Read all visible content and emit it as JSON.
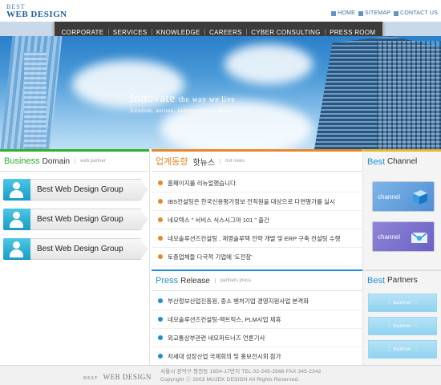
{
  "logo": {
    "line1": "BEST",
    "line2": "WEB DESIGN"
  },
  "util_links": [
    {
      "label": "HOME",
      "icon": "square-bullet-icon"
    },
    {
      "label": "SITEMAP",
      "icon": "square-bullet-icon"
    },
    {
      "label": "CONTACT US",
      "icon": "square-bullet-icon"
    }
  ],
  "nav": [
    "CORPORATE",
    "SERVICES",
    "KNOWLEDGE",
    "CAREERS",
    "CYBER CONSULTING",
    "PRESS ROOM"
  ],
  "hero": {
    "headline": "Innovate",
    "headline_small": "the way we live",
    "subline": "freedom, autono, independence, pride"
  },
  "business": {
    "title_accent": "Business",
    "title_rest": "Domain",
    "small": "web partner",
    "items": [
      "Best Web Design Group",
      "Best Web Design Group",
      "Best Web Design Group"
    ]
  },
  "news": {
    "title_accent": "업계동향",
    "title_rest": "핫뉴스",
    "small": "hot news",
    "items": [
      "홈페이지를 리뉴얼했습니다.",
      "IBS컨설팅은 한국신용평가정보 전직원을 대상으로 다면평가를 실시",
      "네모텍스 \" 서비스 식스시그마 101 \" 출간",
      "네모솔루션즈컨설팅 , 재영솔루텍 전략 개발 및 ERP 구축 컨설팅 수행",
      "토종업체들 다국적 기업에 '도전장'"
    ]
  },
  "press": {
    "title_accent": "Press",
    "title_rest": "Release",
    "small": "partners press",
    "items": [
      "부산정보산업진흥원, 중소 벤처기업 경영지원사업 본격화",
      "네모솔루션즈컨설팅-맥트릭스, PLM사업 제휴",
      "외교통상부관련 네모파트너즈 언론기사",
      "차세대 성장산업 국제회의 및 홍보전시회 참가"
    ]
  },
  "channel": {
    "title_accent": "Best",
    "title_rest": "Channel",
    "items": [
      "channel",
      "channel"
    ]
  },
  "partners": {
    "title_accent": "Best",
    "title_rest": "Partners",
    "banners": [
      ":: banner ::",
      ":: banner ::",
      ":: banner ::"
    ]
  },
  "footer": {
    "logo_small": "BEST",
    "logo_big": "WEB DESIGN",
    "address": "서울시 관악구 봉천동 1654-17번지  TEL 02-245-2566   FAX  345-2342",
    "copyright": "Copyright ⓒ 2003 MUJEK DESIGN All Rights Reserved."
  },
  "colors": {
    "business_accent": "#2fae2f",
    "news_accent": "#e8872a",
    "press_accent": "#1e8fd6",
    "channel_accent": "#1e8fd6",
    "nav_bg": "#3b3b3b",
    "banner": "#8fd2f0"
  }
}
